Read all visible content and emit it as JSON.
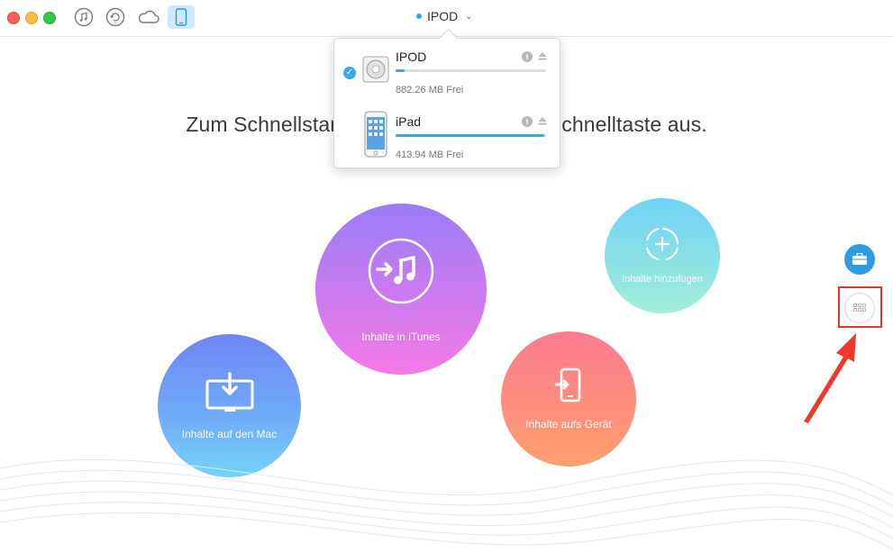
{
  "titlebar": {
    "device_label": "IPOD",
    "toolbar_icons": [
      "itunes-library-icon",
      "backup-restore-icon",
      "icloud-icon",
      "device-icon"
    ]
  },
  "heading": "Zum Schnellstart wählen Sie bitte eine Schnelltaste aus.",
  "device_dropdown": {
    "devices": [
      {
        "name": "IPOD",
        "free": "882.26 MB Frei",
        "used_fraction": 0.06,
        "selected": true
      },
      {
        "name": "iPad",
        "free": "413.94 MB Frei",
        "used_fraction": 0.99,
        "selected": false
      }
    ]
  },
  "shortcuts": {
    "itunes": "Inhalte in iTunes",
    "add": "Inhalte hinzufügen",
    "mac": "Inhalte auf den Mac",
    "device": "Inhalte aufs Gerät"
  },
  "colors": {
    "accent": "#3aa8ea",
    "highlight": "#e8342b"
  }
}
